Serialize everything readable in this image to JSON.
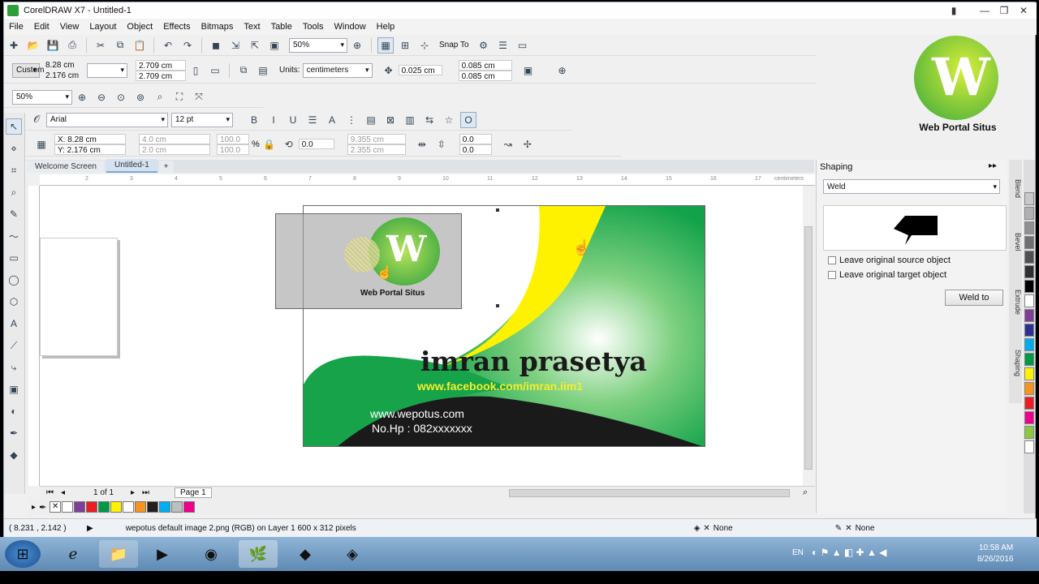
{
  "window": {
    "title": "CorelDRAW X7 - Untitled-1"
  },
  "menu": [
    "File",
    "Edit",
    "View",
    "Layout",
    "Object",
    "Effects",
    "Bitmaps",
    "Text",
    "Table",
    "Tools",
    "Window",
    "Help"
  ],
  "toolbar1": {
    "zoom": "50%",
    "snap_label": "Snap To"
  },
  "props": {
    "preset": "Custom",
    "x": "8.28 cm",
    "y": "2.176 cm",
    "w": "2.709 cm",
    "h": "2.709 cm",
    "units_label": "Units:",
    "units": "centimeters",
    "nudge": "0.025 cm",
    "dup_x": "0.085 cm",
    "dup_y": "0.085 cm"
  },
  "toolbar3": {
    "zoom": "50%"
  },
  "textbar": {
    "font": "Arial",
    "size": "12 pt"
  },
  "objbar": {
    "x": "X: 8.28 cm",
    "y": "Y: 2.176 cm",
    "w": "4.0 cm",
    "h": "2.0 cm",
    "sx": "100.0",
    "sy": "100.0",
    "pct": "%",
    "angle": "0.0",
    "px": "9.355 cm",
    "py": "2.355 cm",
    "sk1": "0.0",
    "sk2": "0.0"
  },
  "tabs": [
    "Welcome Screen",
    "Untitled-1"
  ],
  "ruler": {
    "ticks": [
      "2",
      "3",
      "4",
      "5",
      "6",
      "7",
      "8",
      "9",
      "10",
      "11",
      "12",
      "13",
      "14",
      "15",
      "16",
      "17"
    ],
    "unit": "centimeters"
  },
  "card": {
    "name": "imran prasetya",
    "facebook": "www.facebook.com/imran.iim1",
    "website": "www.wepotus.com",
    "phone": "No.Hp : 082xxxxxxx",
    "logo_text": "Web Portal Situs"
  },
  "watermark": {
    "text": "Web Portal Situs"
  },
  "pagenav": {
    "count": "1 of 1",
    "page": "Page 1"
  },
  "palette": [
    "#ffffff",
    "#7f3f98",
    "#ed1c24",
    "#009a44",
    "#fff200",
    "#ffffff",
    "#f7941d",
    "#231f20",
    "#00aeef",
    "#bcbec0",
    "#ec008c"
  ],
  "right_palette": [
    "#c8c8c8",
    "#b0b0b0",
    "#909090",
    "#707070",
    "#505050",
    "#303030",
    "#000000",
    "#ffffff",
    "#7f3f98",
    "#2e3192",
    "#00aeef",
    "#009a44",
    "#fff200",
    "#f7941d",
    "#ed1c24",
    "#ec008c",
    "#8dc63f",
    "#ffffff"
  ],
  "status": {
    "coords": "( 8.231 , 2.142 )",
    "info": "wepotus default image 2.png (RGB) on Layer 1 600 x 312 pixels",
    "fill": "None",
    "outline": "None"
  },
  "docker": {
    "title": "Shaping",
    "mode": "Weld",
    "opt1": "Leave original source object",
    "opt2": "Leave original target object",
    "button": "Weld to",
    "vtabs": [
      "Blend",
      "Bevel",
      "Extrude",
      "Shaping"
    ]
  },
  "taskbar": {
    "lang": "EN",
    "time": "10:58 AM",
    "date": "8/26/2016"
  }
}
